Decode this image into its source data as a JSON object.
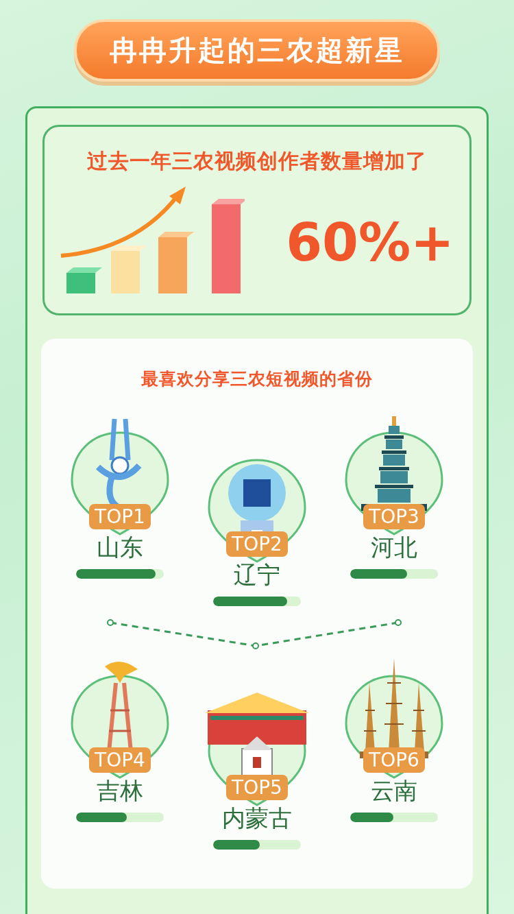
{
  "title": "冉冉升起的三农超新星",
  "growth_card": {
    "headline": "过去一年三农视频创作者数量增加了",
    "value": "60%+"
  },
  "provinces_card": {
    "title": "最喜欢分享三农短视频的省份",
    "provinces": [
      {
        "rank": "TOP1",
        "name": "山东",
        "level": 0.91
      },
      {
        "rank": "TOP2",
        "name": "辽宁",
        "level": 0.84
      },
      {
        "rank": "TOP3",
        "name": "河北",
        "level": 0.65
      },
      {
        "rank": "TOP4",
        "name": "吉林",
        "level": 0.58
      },
      {
        "rank": "TOP5",
        "name": "内蒙古",
        "level": 0.53
      },
      {
        "rank": "TOP6",
        "name": "云南",
        "level": 0.49
      }
    ]
  }
}
